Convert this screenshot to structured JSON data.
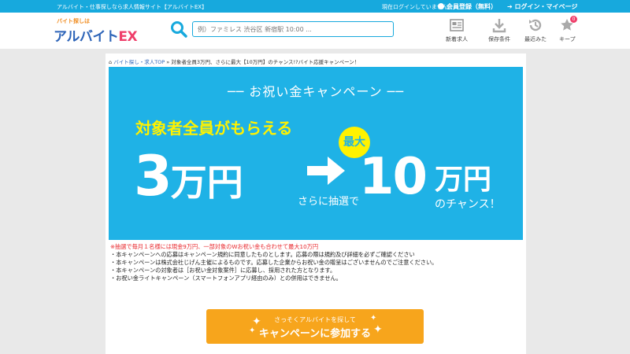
{
  "topbar": {
    "tagline": "アルバイト・仕事探しなら求人情報サイト【アルバイトEX】",
    "status": "現在ログインしていません。",
    "register": "会員登録（無料）",
    "login": "ログイン・マイページ"
  },
  "logo": {
    "small": "バイト探しは",
    "main": "アルバイト",
    "ex": "EX"
  },
  "search": {
    "placeholder": "例）ファミレス 渋谷区 新宿駅 10:00 ..."
  },
  "nav": {
    "new": "新着求人",
    "saved": "保存条件",
    "recent": "最近みた",
    "keep": "キープ",
    "keep_count": "0"
  },
  "breadcrumb": {
    "home": "バイト探し・求人TOP",
    "sep": " » ",
    "current": "対象者全員3万円、さらに最大【10万円】のチャンス!?バイト応援キャンペーン！"
  },
  "banner": {
    "headline": "── お祝い金キャンペーン ──",
    "target": "対象者全員がもらえる",
    "amount1": "3",
    "unit1": "万円",
    "lottery": "さらに抽選で",
    "max": "最大",
    "amount2": "10",
    "unit2": "万円",
    "chance": "のチャンス！"
  },
  "notes": {
    "highlight": "※抽選で毎月１名様には現金9万円、一部対象のWお祝い金も合わせて最大10万円",
    "items": [
      "・本キャンペーンへの応募はキャンペーン規約に同意したものとします。応募の際は規約及び詳細を必ずご確認ください",
      "・本キャンペーンは株式会社じげん主催によるものです。応募した企業からお祝い金の贈呈はございませんのでご注意ください。",
      "・本キャンペーンの対象者は［お祝い金対象案件］に応募し、採用された方となります。",
      "・お祝い金ライトキャンペーン（スマートフォンアプリ経由のみ）との併用はできません。"
    ]
  },
  "cta": {
    "sub": "さっそくアルバイトを探して",
    "main": "キャンペーンに参加する"
  },
  "colors": {
    "accent": "#17a9dd",
    "banner": "#1fb2e6",
    "highlight": "#fff200",
    "cta": "#f7a51c",
    "notice": "#e8262b"
  }
}
